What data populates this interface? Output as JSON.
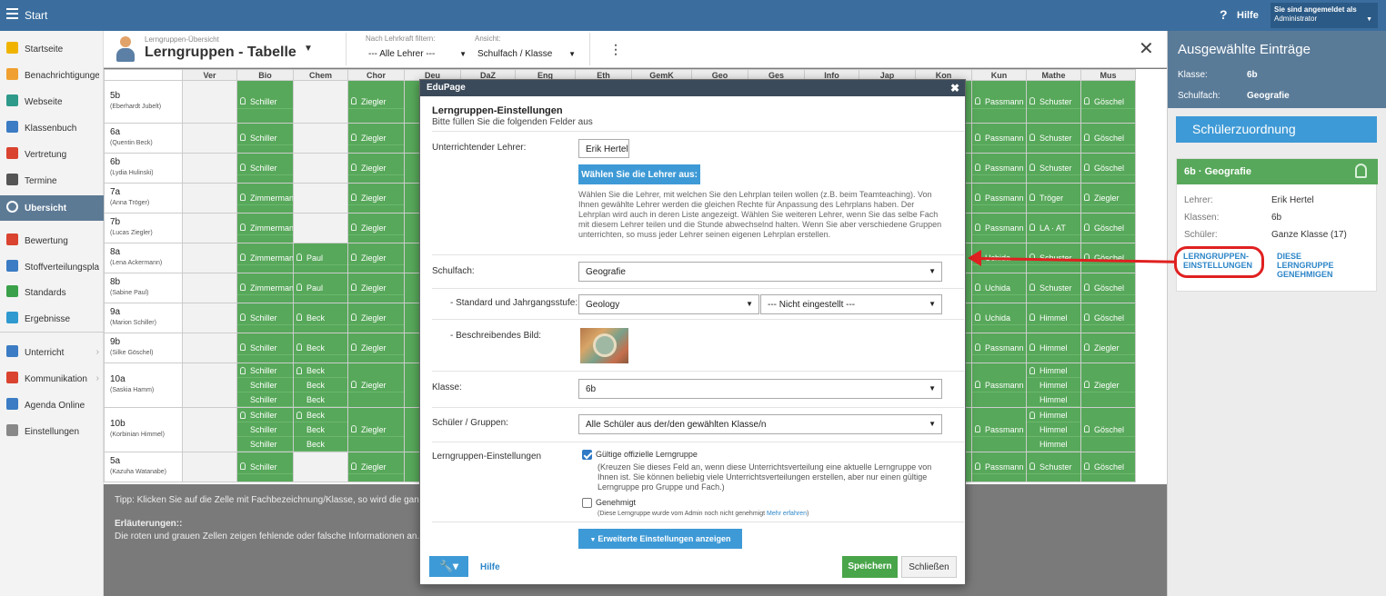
{
  "topbar": {
    "start": "Start",
    "help": "Hilfe",
    "user_line1": "Sie sind angemeldet als",
    "user_line2": "Administrator"
  },
  "sidebar": {
    "items": [
      {
        "label": "Startseite",
        "icon": "star-icon",
        "color": "#f0b400"
      },
      {
        "label": "Benachrichtigungen",
        "icon": "mail-icon",
        "color": "#f0a030"
      },
      {
        "label": "Webseite",
        "icon": "home-icon",
        "color": "#2e9a8a"
      },
      {
        "label": "Klassenbuch",
        "icon": "book-icon",
        "color": "#3b7cc4"
      },
      {
        "label": "Vertretung",
        "icon": "person-icon",
        "color": "#d9432f"
      },
      {
        "label": "Termine",
        "icon": "calendar-icon",
        "color": "#555555"
      },
      {
        "label": "Übersicht",
        "icon": "check-circle-icon",
        "color": "#ffffff"
      },
      {
        "label": "Bewertung",
        "icon": "grade-icon",
        "color": "#d9432f"
      },
      {
        "label": "Stoffverteilungsplan",
        "icon": "layers-icon",
        "color": "#3b7cc4"
      },
      {
        "label": "Standards",
        "icon": "shield-icon",
        "color": "#3aa14a"
      },
      {
        "label": "Ergebnisse",
        "icon": "bar-chart-icon",
        "color": "#2e9ad0"
      },
      {
        "label": "Unterricht",
        "icon": "briefcase-icon",
        "color": "#3b7cc4"
      },
      {
        "label": "Kommunikation",
        "icon": "chat-icon",
        "color": "#d9432f"
      },
      {
        "label": "Agenda Online",
        "icon": "pen-icon",
        "color": "#3b7cc4"
      },
      {
        "label": "Einstellungen",
        "icon": "gear-icon",
        "color": "#888888"
      }
    ]
  },
  "header": {
    "subtitle": "Lerngruppen-Übersicht",
    "title": "Lerngruppen - Tabelle",
    "filter_label": "Nach Lehrkraft filtern:",
    "filter_value": "--- Alle Lehrer ---",
    "view_label": "Ansicht:",
    "view_value": "Schulfach / Klasse"
  },
  "grid": {
    "columns": [
      "Ver",
      "Bio",
      "Chem",
      "Chor",
      "Deu",
      "DaZ",
      "Eng",
      "Eth",
      "GemK",
      "Geo",
      "Ges",
      "Info",
      "Jap",
      "Kon",
      "Kun",
      "Mathe",
      "Mus"
    ],
    "rows": [
      {
        "cls": "5b",
        "teacher": "(Eberhardt Jubelt)",
        "Bio": [
          "Schiller"
        ],
        "Chem": [],
        "Chor": [
          "Ziegler"
        ],
        "Kun": [
          "Passmann"
        ],
        "Mathe": [
          "Schuster"
        ],
        "Mus": [
          "Göschel"
        ]
      },
      {
        "cls": "6a",
        "teacher": "(Quentin Beck)",
        "Bio": [
          "Schiller"
        ],
        "Chem": [],
        "Chor": [
          "Ziegler"
        ],
        "Kun": [
          "Passmann"
        ],
        "Mathe": [
          "Schuster"
        ],
        "Mus": [
          "Göschel"
        ]
      },
      {
        "cls": "6b",
        "teacher": "(Lydia Hulinski)",
        "Bio": [
          "Schiller"
        ],
        "Chem": [],
        "Chor": [
          "Ziegler"
        ],
        "Kun": [
          "Passmann"
        ],
        "Mathe": [
          "Schuster"
        ],
        "Mus": [
          "Göschel"
        ]
      },
      {
        "cls": "7a",
        "teacher": "(Anna Tröger)",
        "Bio": [
          "Zimmermann"
        ],
        "Chem": [],
        "Chor": [
          "Ziegler"
        ],
        "Kun": [
          "Passmann"
        ],
        "Mathe": [
          "Tröger"
        ],
        "Mus": [
          "Ziegler"
        ]
      },
      {
        "cls": "7b",
        "teacher": "(Lucas Ziegler)",
        "Bio": [
          "Zimmermann"
        ],
        "Chem": [],
        "Chor": [
          "Ziegler"
        ],
        "Kun": [
          "Passmann"
        ],
        "Mathe": [
          "LA · AT"
        ],
        "Mus": [
          "Göschel"
        ]
      },
      {
        "cls": "8a",
        "teacher": "(Lena Ackermann)",
        "Bio": [
          "Zimmermann"
        ],
        "Chem": [
          "Paul"
        ],
        "Chor": [
          "Ziegler"
        ],
        "Kun": [
          "Uchida"
        ],
        "Mathe": [
          "Schuster"
        ],
        "Mus": [
          "Göschel"
        ]
      },
      {
        "cls": "8b",
        "teacher": "(Sabine Paul)",
        "Bio": [
          "Zimmermann"
        ],
        "Chem": [
          "Paul"
        ],
        "Chor": [
          "Ziegler"
        ],
        "Kun": [
          "Uchida"
        ],
        "Mathe": [
          "Schuster"
        ],
        "Mus": [
          "Göschel"
        ]
      },
      {
        "cls": "9a",
        "teacher": "(Marion Schiller)",
        "Bio": [
          "Schiller"
        ],
        "Chem": [
          "Beck"
        ],
        "Chor": [
          "Ziegler"
        ],
        "Kun": [
          "Uchida"
        ],
        "Mathe": [
          "Himmel"
        ],
        "Mus": [
          "Göschel"
        ]
      },
      {
        "cls": "9b",
        "teacher": "(Silke Göschel)",
        "Bio": [
          "Schiller"
        ],
        "Chem": [
          "Beck"
        ],
        "Chor": [
          "Ziegler"
        ],
        "Kun": [
          "Passmann"
        ],
        "Mathe": [
          "Himmel"
        ],
        "Mus": [
          "Ziegler"
        ]
      },
      {
        "cls": "10a",
        "teacher": "(Saskia Hamm)",
        "Bio": [
          "Schiller",
          "Schiller",
          "Schiller"
        ],
        "Chem": [
          "Beck",
          "Beck",
          "Beck"
        ],
        "Chor": [
          "Ziegler"
        ],
        "Kun": [
          "Passmann"
        ],
        "Mathe": [
          "Himmel",
          "Himmel",
          "Himmel"
        ],
        "Mus": [
          "Ziegler"
        ]
      },
      {
        "cls": "10b",
        "teacher": "(Korbinian Himmel)",
        "Bio": [
          "Schiller",
          "Schiller",
          "Schiller"
        ],
        "Chem": [
          "Beck",
          "Beck",
          "Beck"
        ],
        "Chor": [
          "Ziegler"
        ],
        "Kun": [
          "Passmann"
        ],
        "Mathe": [
          "Himmel",
          "Himmel",
          "Himmel"
        ],
        "Mus": [
          "Göschel"
        ]
      },
      {
        "cls": "5a",
        "teacher": "(Kazuha Watanabe)",
        "Bio": [
          "Schiller"
        ],
        "Chem": [],
        "Chor": [
          "Ziegler"
        ],
        "Kun": [
          "Passmann"
        ],
        "Mathe": [
          "Schuster"
        ],
        "Mus": [
          "Göschel"
        ]
      }
    ],
    "tip": "Tipp: Klicken Sie auf die Zelle mit Fachbezeichnung/Klasse, so wird die ganze",
    "legend_title": "Erläuterungen::",
    "legend_text": "Die roten und grauen Zellen zeigen fehlende oder falsche Informationen an. Kl"
  },
  "right_panel": {
    "title": "Ausgewählte Einträge",
    "class_label": "Klasse:",
    "class_value": "6b",
    "subject_label": "Schulfach:",
    "subject_value": "Geografie",
    "assign_button": "Schülerzuordnung",
    "card_title": "6b · Geografie",
    "teacher_label": "Lehrer:",
    "teacher_value": "Erik Hertel",
    "classes_label": "Klassen:",
    "classes_value": "6b",
    "students_label": "Schüler:",
    "students_value": "Ganze Klasse (17)",
    "link_settings": "LERNGRUPPEN-EINSTELLUNGEN",
    "link_approve": "DIESE LERNGRUPPE GENEHMIGEN"
  },
  "modal": {
    "titlebar": "EduPage",
    "heading": "Lerngruppen-Einstellungen",
    "subheading": "Bitte füllen Sie die folgenden Felder aus",
    "teacher_label": "Unterrichtender Lehrer:",
    "teacher_value": "Erik Hertel",
    "choose_teacher_button": "Wählen Sie die Lehrer aus:",
    "description": "Wählen Sie die Lehrer, mit welchen Sie den Lehrplan teilen wollen (z.B. beim Teamteaching). Von Ihnen gewählte Lehrer werden die gleichen Rechte für Anpassung des Lehrplans haben. Der Lehrplan wird auch in deren Liste angezeigt. Wählen Sie weiteren Lehrer, wenn Sie das selbe Fach mit diesem Lehrer teilen und die Stunde abwechselnd halten. Wenn Sie aber verschiedene Gruppen unterrichten, so muss jeder Lehrer seinen eigenen Lehrplan erstellen.",
    "subject_label": "Schulfach:",
    "subject_value": "Geografie",
    "standard_label": "- Standard und Jahrgangsstufe:",
    "standard_value": "Geology",
    "grade_value": "--- Nicht eingestellt ---",
    "image_label": "- Beschreibendes Bild:",
    "class_label": "Klasse:",
    "class_value": "6b",
    "students_label": "Schüler / Gruppen:",
    "students_value": "Alle Schüler aus der/den gewählten Klasse/n",
    "settings_label": "Lerngruppen-Einstellungen",
    "valid_label": "Gültige offizielle Lerngruppe",
    "valid_checked": true,
    "valid_help": "(Kreuzen Sie dieses Feld an, wenn diese Unterrichtsverteilung eine aktuelle Lerngruppe von Ihnen ist. Sie können beliebig viele Unterrichtsverteilungen erstellen, aber nur einen gültige Lerngruppe pro Gruppe und Fach.)",
    "approved_label": "Genehmigt",
    "approved_checked": false,
    "approved_help": "(Diese Lerngruppe wurde vom Admin noch nicht genehmigt ",
    "learn_more": "Mehr erfahren",
    "approved_help_end": ")",
    "advanced_button": "Erweiterte Einstellungen anzeigen",
    "help_link": "Hilfe",
    "save_button": "Speichern",
    "close_button": "Schließen"
  }
}
